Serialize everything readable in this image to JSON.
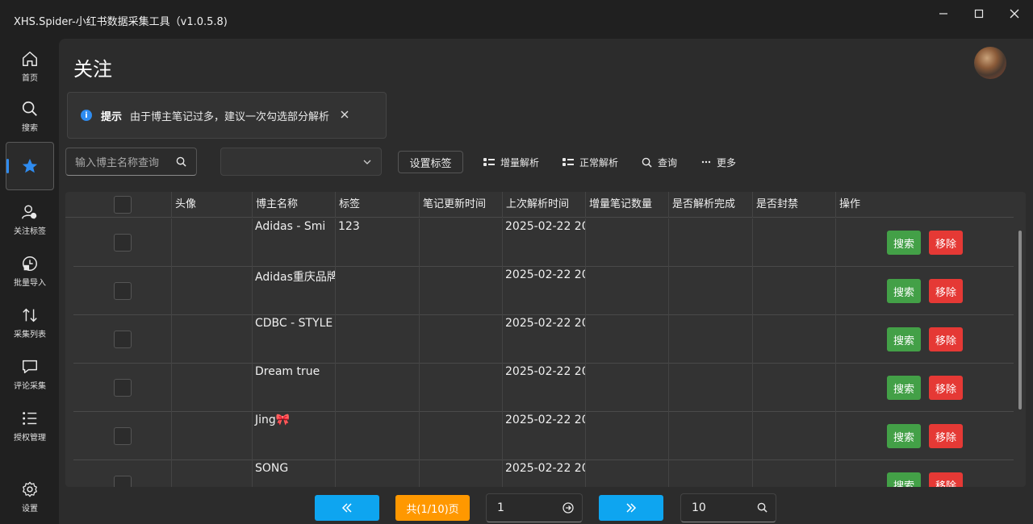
{
  "app": {
    "title": "XHS.Spider-小红书数据采集工具（v1.0.5.8)"
  },
  "sidebar": {
    "items": [
      {
        "label": "首页",
        "icon": "home-icon"
      },
      {
        "label": "搜索",
        "icon": "search-icon"
      },
      {
        "label": "",
        "icon": "star-icon",
        "active": true
      },
      {
        "label": "关注标签",
        "icon": "user-tag-icon"
      },
      {
        "label": "批量导入",
        "icon": "import-icon"
      },
      {
        "label": "采集列表",
        "icon": "sort-arrows-icon"
      },
      {
        "label": "评论采集",
        "icon": "comment-icon"
      },
      {
        "label": "授权管理",
        "icon": "list-icon"
      },
      {
        "label": "设置",
        "icon": "gear-icon"
      }
    ]
  },
  "page": {
    "title": "关注"
  },
  "tip": {
    "head": "提示",
    "text": "由于博主笔记过多，建议一次勾选部分解析"
  },
  "toolbar": {
    "search_placeholder": "输入博主名称查询",
    "select_value": "",
    "set_tag": "设置标签",
    "incremental": "增量解析",
    "normal": "正常解析",
    "query": "查询",
    "more": "更多"
  },
  "table": {
    "headers": [
      "",
      "头像",
      "博主名称",
      "标签",
      "笔记更新时间",
      "上次解析时间",
      "增量笔记数量",
      "是否解析完成",
      "是否封禁",
      "操作"
    ],
    "rows": [
      {
        "name": "Adidas - Smi",
        "tag": "123",
        "last": "2025-02-22 20"
      },
      {
        "name": "Adidas重庆品牌",
        "tag": "",
        "last": "2025-02-22 20"
      },
      {
        "name": "CDBC - STYLE",
        "tag": "",
        "last": "2025-02-22 20"
      },
      {
        "name": "Dream true",
        "tag": "",
        "last": "2025-02-22 20"
      },
      {
        "name": "Jing🎀",
        "tag": "",
        "last": "2025-02-22 20"
      },
      {
        "name": "SONG",
        "tag": "",
        "last": "2025-02-22 20"
      }
    ],
    "search_label": "搜索",
    "remove_label": "移除"
  },
  "pagination": {
    "page_info": "共(1/10)页",
    "page_input": "1",
    "page_size": "10"
  },
  "colors": {
    "accent": "#2f8cf0",
    "success": "#43a047",
    "danger": "#e53935",
    "pager_blue": "#0ea5f0",
    "pager_orange": "#ff9800"
  }
}
